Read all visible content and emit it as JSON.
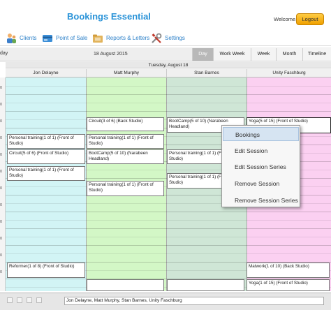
{
  "header": {
    "title": "Bookings Essential",
    "welcome": "Welcome,",
    "logout": "Logout"
  },
  "menu": [
    {
      "label": "Clients",
      "icon": "clients-icon"
    },
    {
      "label": "Point of Sale",
      "icon": "point-of-sale-icon"
    },
    {
      "label": "Reports & Letters",
      "icon": "reports-icon"
    },
    {
      "label": "Settings",
      "icon": "settings-icon"
    }
  ],
  "nav": {
    "prev_label": "day",
    "date": "18 August 2015",
    "views": [
      "Day",
      "Work Week",
      "Week",
      "Month",
      "Timeline"
    ],
    "active_view": "Day"
  },
  "calendar": {
    "day_header": "Tuesday, August 18",
    "resources": [
      "Jon Delayne",
      "Matt Murphy",
      "Stan Barnes",
      "Unity Faschburg"
    ],
    "time_labels": [
      "0",
      "0",
      "0",
      "0",
      "0",
      "0",
      "0",
      "0",
      "0",
      "0",
      "0",
      "0"
    ]
  },
  "appointments": [
    {
      "text": "Circuit(3 of 6) (Back Studio)",
      "resource": "Matt Murphy"
    },
    {
      "text": "BootCamp(5 of 10) (Narabeen Headland)",
      "resource": "Stan Barnes"
    },
    {
      "text": "Yoga(5 of 15) (Front of Studio)",
      "resource": "Unity Faschburg"
    },
    {
      "text": "Personal training(1 of 1) (Front of Studio)",
      "resource": "Jon Delayne"
    },
    {
      "text": "Personal training(1 of 1) (Front of Studio)",
      "resource": "Matt Murphy"
    },
    {
      "text": "Circuit(5 of 6) (Front of Studio)",
      "resource": "Jon Delayne"
    },
    {
      "text": "BootCamp(5 of 10) (Narabeen Headland)",
      "resource": "Matt Murphy"
    },
    {
      "text": "Personal training(1 of 1) (Front of Studio)",
      "resource": "Stan Barnes"
    },
    {
      "text": "Personal training(1 of 1) (Front of Studio)",
      "resource": "Jon Delayne"
    },
    {
      "text": "Personal training(1 of 1) (Front of Studio)",
      "resource": "Stan Barnes"
    },
    {
      "text": "Personal training(1 of 1) (Front of Studio)",
      "resource": "Matt Murphy"
    },
    {
      "text": "Reformer(1 of 8) (Front of Studio)",
      "resource": "Jon Delayne"
    },
    {
      "text": "Matwork(1 of 10) (Back Studio)",
      "resource": "Unity Faschburg"
    },
    {
      "text": "Yoga(1 of 15) (Front of Studio)",
      "resource": "Unity Faschburg"
    }
  ],
  "context_menu": {
    "items": [
      "Bookings",
      "Edit Session",
      "Edit Session Series",
      "Remove Session",
      "Remove Session Series"
    ],
    "highlighted": "Bookings"
  },
  "footer": {
    "resource_selection": "Jon Delayne, Matt Murphy, Stan Barnes, Unity Faschburg"
  },
  "colors": {
    "title": "#2a93d8",
    "logout": "#f5b400",
    "jon": "#d2f4f5",
    "matt": "#d3f7c6",
    "stan": "#cfe6d6",
    "unity": "#fbd0f1"
  }
}
